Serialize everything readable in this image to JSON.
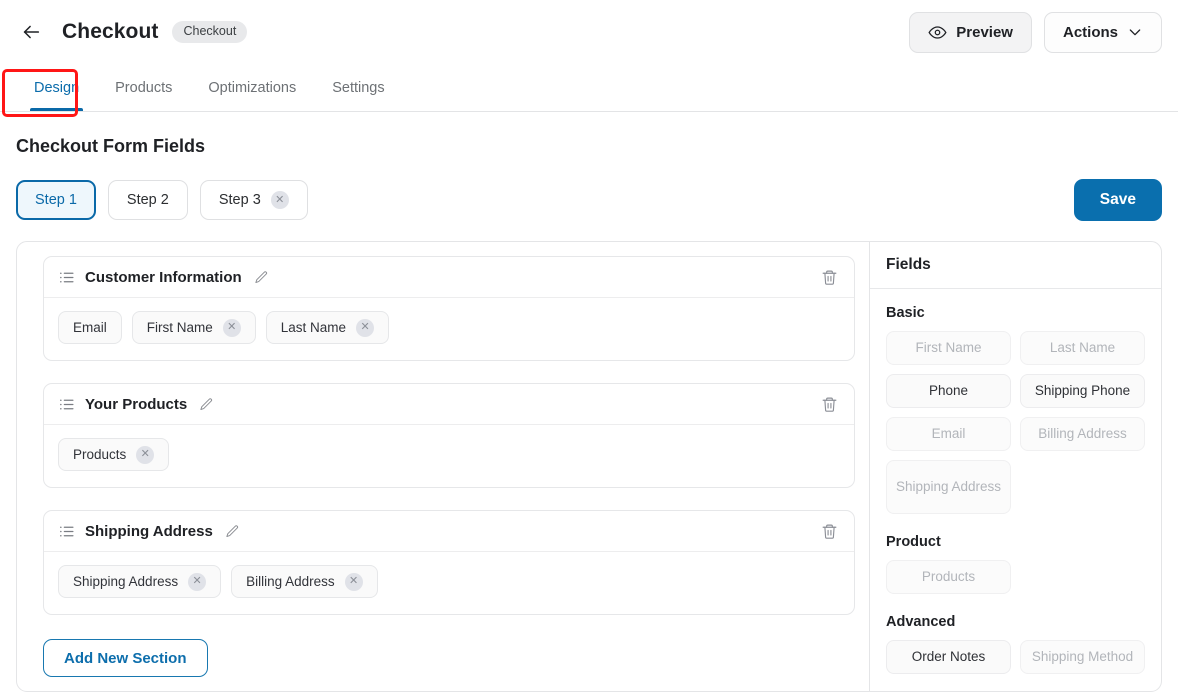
{
  "header": {
    "back_icon": "arrow-left-icon",
    "title": "Checkout",
    "badge": "Checkout",
    "preview_label": "Preview",
    "preview_icon": "eye-icon",
    "actions_label": "Actions",
    "actions_icon": "chevron-down-icon"
  },
  "tabs": [
    {
      "label": "Design",
      "active": true
    },
    {
      "label": "Products",
      "active": false
    },
    {
      "label": "Optimizations",
      "active": false
    },
    {
      "label": "Settings",
      "active": false
    }
  ],
  "annotation": {
    "color": "#ff1616",
    "target": "Design"
  },
  "form": {
    "heading": "Checkout Form Fields",
    "save_label": "Save",
    "add_section_label": "Add New Section"
  },
  "steps": [
    {
      "label": "Step 1",
      "active": true,
      "removable": false
    },
    {
      "label": "Step 2",
      "active": false,
      "removable": false
    },
    {
      "label": "Step 3",
      "active": false,
      "removable": true
    }
  ],
  "sections": [
    {
      "title": "Customer Information",
      "drag_icon": "list-icon",
      "edit_icon": "pencil-icon",
      "delete_icon": "trash-icon",
      "fields": [
        {
          "label": "Email",
          "removable": false
        },
        {
          "label": "First Name",
          "removable": true
        },
        {
          "label": "Last Name",
          "removable": true
        }
      ]
    },
    {
      "title": "Your Products",
      "drag_icon": "list-icon",
      "edit_icon": "pencil-icon",
      "delete_icon": "trash-icon",
      "fields": [
        {
          "label": "Products",
          "removable": true
        }
      ]
    },
    {
      "title": "Shipping Address",
      "drag_icon": "list-icon",
      "edit_icon": "pencil-icon",
      "delete_icon": "trash-icon",
      "fields": [
        {
          "label": "Shipping Address",
          "removable": true
        },
        {
          "label": "Billing Address",
          "removable": true
        }
      ]
    }
  ],
  "fields_panel": {
    "title": "Fields",
    "groups": [
      {
        "label": "Basic",
        "items": [
          {
            "label": "First Name",
            "disabled": true
          },
          {
            "label": "Last Name",
            "disabled": true
          },
          {
            "label": "Phone",
            "disabled": false
          },
          {
            "label": "Shipping Phone",
            "disabled": false
          },
          {
            "label": "Email",
            "disabled": true
          },
          {
            "label": "Billing Address",
            "disabled": true
          },
          {
            "label": "Shipping Address",
            "disabled": true,
            "tall": true
          }
        ]
      },
      {
        "label": "Product",
        "items": [
          {
            "label": "Products",
            "disabled": true
          }
        ]
      },
      {
        "label": "Advanced",
        "items": [
          {
            "label": "Order Notes",
            "disabled": false
          },
          {
            "label": "Shipping Method",
            "disabled": true
          }
        ]
      }
    ]
  },
  "colors": {
    "accent": "#0a6fae",
    "annotation": "#ff1616",
    "text": "#1f2125",
    "muted": "#6d7175"
  }
}
